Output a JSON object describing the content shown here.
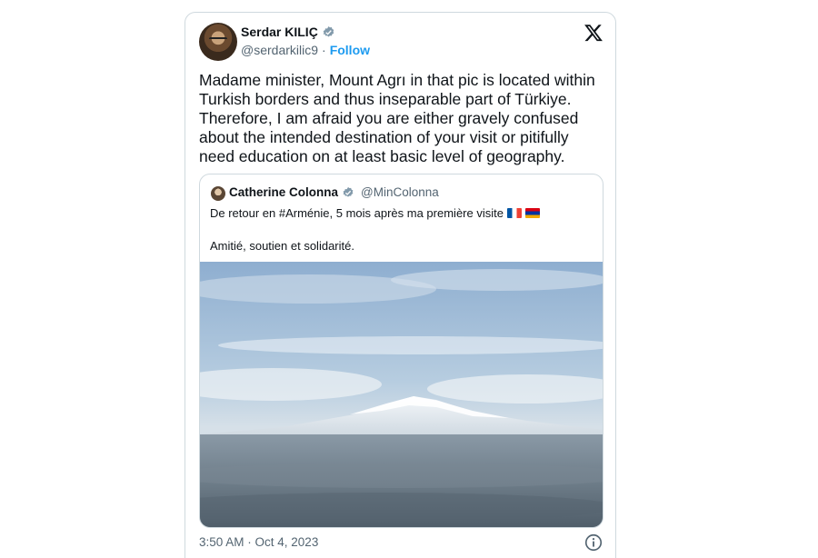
{
  "author": {
    "name": "Serdar KILIÇ",
    "handle": "@serdarkilic9",
    "separator": "·",
    "follow_label": "Follow"
  },
  "tweet": {
    "text": "Madame minister, Mount Agrı in that pic is located within\nTurkish borders and thus inseparable part of Türkiye.\nTherefore, I am afraid you are either gravely confused\nabout the intended destination of your visit or pitifully\nneed education on at least basic level of geography.",
    "timestamp": "3:50 AM · Oct 4, 2023"
  },
  "quoted": {
    "name": "Catherine Colonna",
    "handle": "@MinColonna",
    "line1": "De retour en #Arménie, 5 mois après ma première visite",
    "line2": "Amitié, soutien et solidarité."
  },
  "icons": {
    "verified": "verified-badge-icon",
    "x": "x-logo-icon",
    "info": "info-icon"
  },
  "colors": {
    "accent": "#1d9bf0",
    "muted": "#536471",
    "text": "#0f1419",
    "border": "#cfd9de"
  }
}
